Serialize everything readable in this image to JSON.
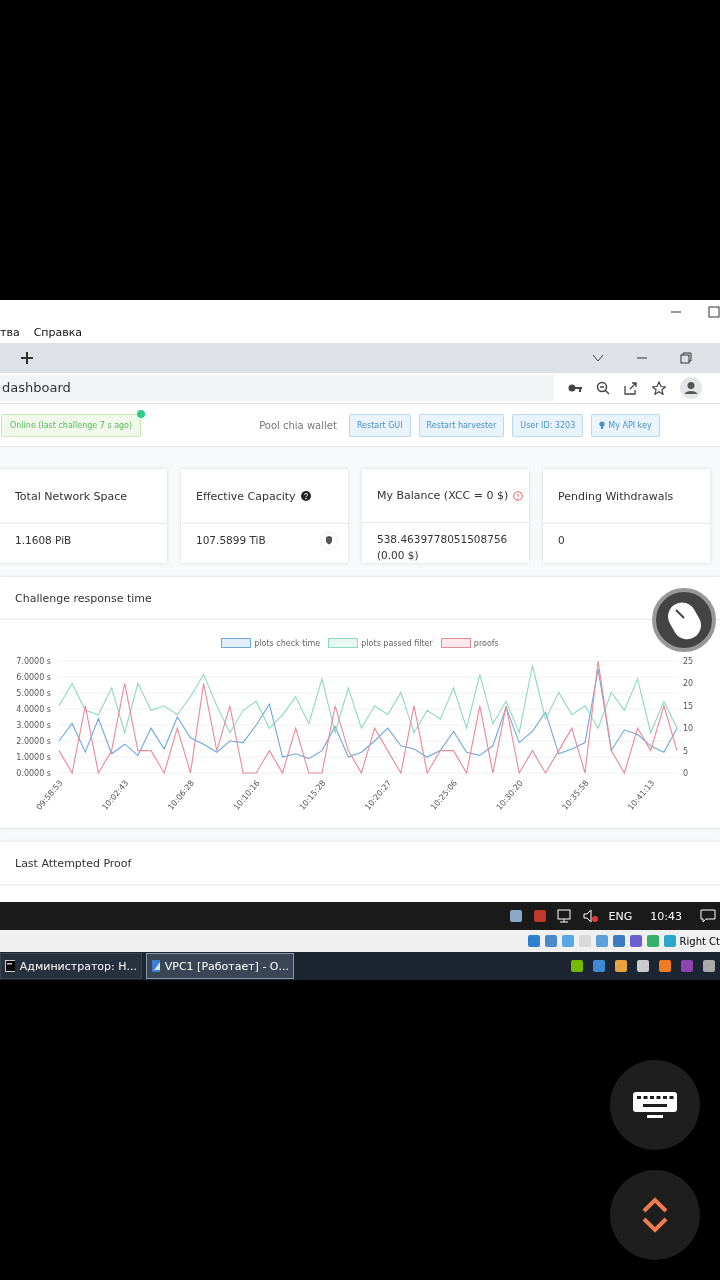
{
  "menu": [
    "тва",
    "Справка"
  ],
  "address": {
    "value": "dashboard"
  },
  "toolbar": {
    "status": "Online (last challenge 7 s ago)",
    "online": true,
    "wallet": "Pool chia wallet",
    "buttons": [
      "Restart GUI",
      "Restart harvester",
      "User ID: 3203",
      "My API key"
    ]
  },
  "cards": [
    {
      "title": "Total Network Space",
      "value": "1.1608 PiB",
      "kind": "plain"
    },
    {
      "title": "Effective Capacity",
      "value": "107.5899 TiB",
      "kind": "help"
    },
    {
      "title": "My Balance (XCC = 0 $)",
      "value": "538.4639778051508756",
      "sub": "(0.00 $)",
      "kind": "warning"
    },
    {
      "title": "Pending Withdrawals",
      "value": "0",
      "kind": "plain"
    }
  ],
  "chart_panel": {
    "title": "Challenge response time",
    "chart_data": {
      "type": "line",
      "grid": true,
      "categories": [
        "09:58:53",
        null,
        null,
        null,
        null,
        "10:02:43",
        null,
        null,
        null,
        null,
        "10:06:28",
        null,
        null,
        null,
        null,
        "10:10:16",
        null,
        null,
        null,
        null,
        "10:15:28",
        null,
        null,
        null,
        null,
        "10:20:27",
        null,
        null,
        null,
        null,
        "10:25:06",
        null,
        null,
        null,
        null,
        "10:30:20",
        null,
        null,
        null,
        null,
        "10:35:58",
        null,
        null,
        null,
        null,
        "10:41:13",
        null,
        null
      ],
      "ylim": [
        0,
        7
      ],
      "yticks": [
        {
          "value": 0,
          "label": "0.0000 s"
        },
        {
          "value": 1,
          "label": "1.0000 s"
        },
        {
          "value": 2,
          "label": "2.0000 s"
        },
        {
          "value": 3,
          "label": "3.0000 s"
        },
        {
          "value": 4,
          "label": "4.0000 s"
        },
        {
          "value": 5,
          "label": "5.0000 s"
        },
        {
          "value": 6,
          "label": "6.0000 s"
        },
        {
          "value": 7,
          "label": "7.0000 s"
        }
      ],
      "y2lim": [
        0,
        25
      ],
      "y2ticks": [
        0,
        5,
        10,
        15,
        20,
        25
      ],
      "series": [
        {
          "name": "plots check time",
          "color": "#6fa8dc",
          "values": [
            2.0,
            3.1,
            1.3,
            3.4,
            1.2,
            1.8,
            1.1,
            2.8,
            1.5,
            3.5,
            2.2,
            1.8,
            1.3,
            2.0,
            1.9,
            3.0,
            4.3,
            1.0,
            1.2,
            0.9,
            1.4,
            2.9,
            1.0,
            1.3,
            2.0,
            2.8,
            1.7,
            1.5,
            1.0,
            1.4,
            2.6,
            1.3,
            1.1,
            1.7,
            4.1,
            1.9,
            2.6,
            3.8,
            1.2,
            1.5,
            1.9,
            6.5,
            1.4,
            2.7,
            2.4,
            1.7,
            1.3,
            2.8
          ]
        },
        {
          "name": "plots passed filter",
          "color": "#8fd8c0",
          "axis": "y2",
          "values": [
            15,
            20,
            14,
            13,
            19,
            9,
            20,
            14,
            15,
            13,
            17,
            22,
            15,
            9,
            14,
            16,
            10,
            13,
            17,
            11,
            21,
            9,
            19,
            10,
            15,
            13,
            18,
            9,
            14,
            12,
            19,
            10,
            22,
            11,
            16,
            9,
            24,
            12,
            18,
            13,
            15,
            10,
            18,
            14,
            21,
            9,
            16,
            10
          ]
        },
        {
          "name": "proofs",
          "color": "#e88a9a",
          "axis": "y2",
          "values": [
            5,
            0,
            15,
            0,
            5,
            20,
            5,
            5,
            0,
            10,
            0,
            20,
            5,
            15,
            0,
            0,
            5,
            0,
            10,
            0,
            0,
            15,
            5,
            0,
            10,
            5,
            0,
            15,
            0,
            5,
            5,
            0,
            15,
            0,
            15,
            0,
            5,
            0,
            5,
            10,
            0,
            25,
            5,
            0,
            10,
            5,
            15,
            5
          ]
        }
      ]
    }
  },
  "proof_panel": {
    "title": "Last Attempted Proof"
  },
  "guest_tray": {
    "language": "ENG",
    "time": "10:43"
  },
  "vm_status": {
    "hostkey": "Right Ct"
  },
  "host_taskbar": [
    {
      "label": "Администратор: Н...",
      "selected": false
    },
    {
      "label": "VPC1 [Работает] - О...",
      "selected": true
    }
  ]
}
